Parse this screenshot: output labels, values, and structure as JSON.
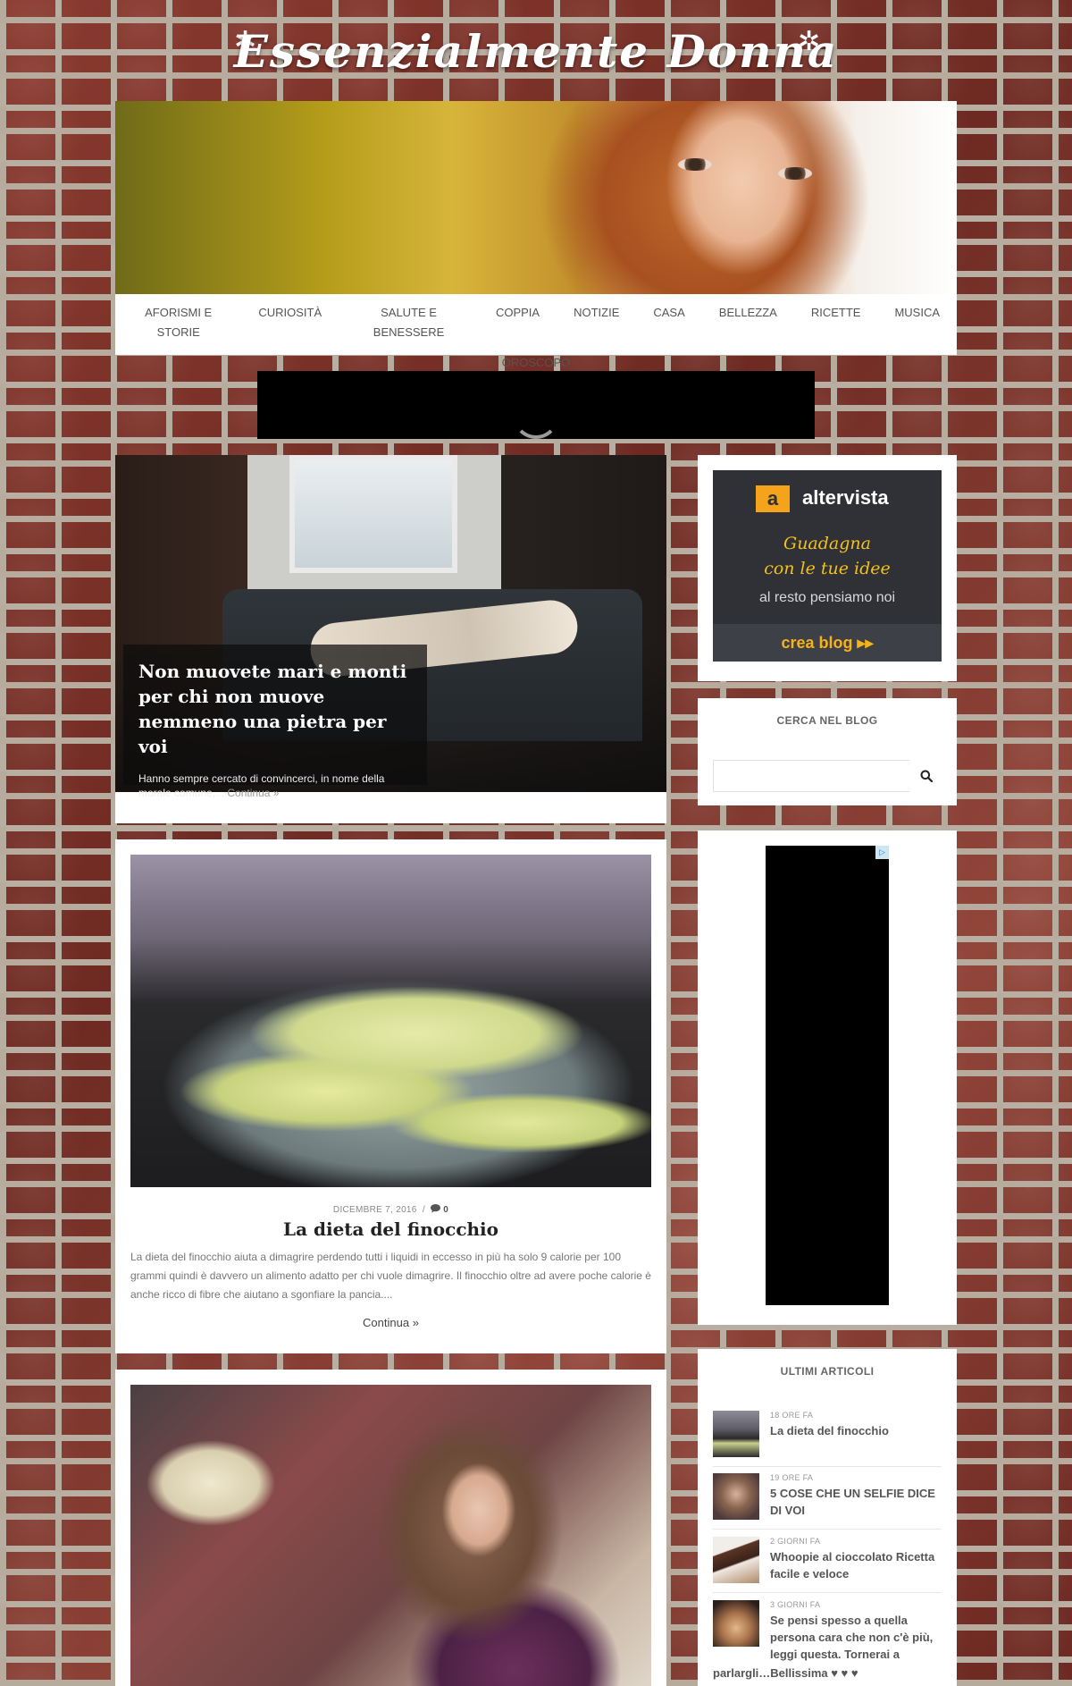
{
  "site": {
    "title": "Essenzialmente Donna",
    "flower_glyph": "✲"
  },
  "nav": {
    "row1": [
      "AFORISMI E STORIE",
      "CURIOSITÀ",
      "SALUTE E BENESSERE",
      "COPPIA",
      "NOTIZIE",
      "CASA",
      "BELLEZZA",
      "RICETTE",
      "MUSICA"
    ],
    "row2": [
      "OROSCOPO"
    ]
  },
  "featured": {
    "title": "Non muovete mari e monti per chi non muove nemmeno una pietra per voi",
    "excerpt": "Hanno sempre cercato di convincerci, in nome della morale comune,...",
    "more": "Continua »"
  },
  "posts": [
    {
      "date": "DICEMBRE 7, 2016",
      "separator": "/",
      "comments": "0",
      "title": "La dieta del finocchio",
      "excerpt": "La dieta del finocchio aiuta a dimagrire perdendo tutti i liquidi in eccesso in più ha solo 9 calorie per 100 grammi quindi è davvero un alimento adatto per chi vuole dimagrire. Il finocchio oltre ad avere poche calorie è anche ricco di fibre che aiutano a sgonfiare la pancia....",
      "more": "Continua »"
    }
  ],
  "sidebar": {
    "altervista": {
      "logo_letter": "a",
      "brand": "altervista",
      "tagline_1": "Guadagna",
      "tagline_2": "con le tue idee",
      "sub": "al resto pensiamo noi",
      "cta": "crea blog ▸▸"
    },
    "search": {
      "title": "CERCA NEL BLOG",
      "placeholder": ""
    },
    "ad_choice": "▷",
    "latest": {
      "title": "ULTIMI ARTICOLI",
      "items": [
        {
          "time": "18 ORE FA",
          "title": "La dieta del finocchio"
        },
        {
          "time": "19 ORE FA",
          "title": "5 COSE CHE UN SELFIE DICE DI VOI"
        },
        {
          "time": "2 GIORNI FA",
          "title": "Whoopie al cioccolato Ricetta facile e veloce"
        },
        {
          "time": "3 GIORNI FA",
          "title": "Se pensi spesso a quella persona cara che non c'è più, leggi questa. Tornerai a",
          "title_cont": "parlargli…Bellissima ♥ ♥ ♥"
        }
      ]
    }
  },
  "colors": {
    "brick": "#7a2f26",
    "mortar": "#b9aea2",
    "altervista_bg": "#2f3137",
    "altervista_accent": "#f5a31a"
  }
}
